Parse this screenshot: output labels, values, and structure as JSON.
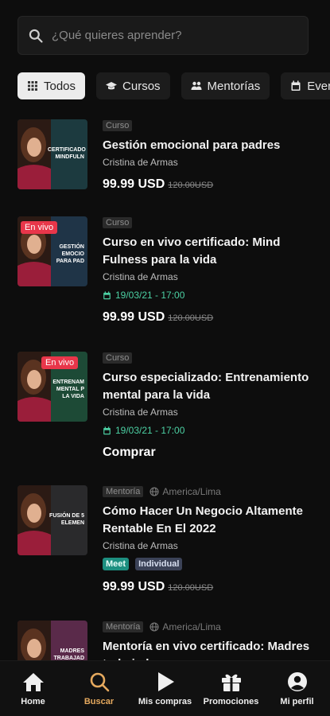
{
  "search": {
    "placeholder": "¿Qué quieres aprender?"
  },
  "filters": [
    {
      "label": "Todos",
      "icon": "grid-icon"
    },
    {
      "label": "Cursos",
      "icon": "graduation-cap-icon"
    },
    {
      "label": "Mentorías",
      "icon": "users-icon"
    },
    {
      "label": "Even",
      "icon": "calendar-icon"
    }
  ],
  "items": [
    {
      "type": "Curso",
      "title": "Gestión emocional para padres",
      "author": "Cristina de Armas",
      "price": "99.99 USD",
      "old_price": "120.00USD",
      "thumb_text": "Certificado MINDFULN",
      "thumb_bg": "#1c3a3f"
    },
    {
      "type": "Curso",
      "live": "En vivo",
      "title": "Curso en vivo certificado: Mind Fulness para la vida",
      "author": "Cristina de Armas",
      "date": "19/03/21 - 17:00",
      "price": "99.99 USD",
      "old_price": "120.00USD",
      "thumb_text": "Gestión emocio para pad",
      "thumb_bg": "#1f3447"
    },
    {
      "type": "Curso",
      "live": "En vivo",
      "title": "Curso especializado: Entrenamiento mental para la vida",
      "author": "Cristina de Armas",
      "date": "19/03/21 - 17:00",
      "cta": "Comprar",
      "thumb_text": "Entrenam mental p la vida",
      "thumb_bg": "#1d4a36"
    },
    {
      "type": "Mentoría",
      "timezone": "America/Lima",
      "title": "Cómo Hacer Un Negocio Altamente Rentable En El 2022",
      "author": "Cristina de Armas",
      "badges": [
        "Meet",
        "Individual"
      ],
      "price": "99.99 USD",
      "old_price": "120.00USD",
      "thumb_text": "Fusión de 5 elemen",
      "thumb_bg": "#2a2a2c"
    },
    {
      "type": "Mentoría",
      "timezone": "America/Lima",
      "title": "Mentoría en vivo certificado: Madres trabajadoras",
      "thumb_text": "Madres trabajad",
      "thumb_bg": "#5a2a4a"
    }
  ],
  "nav": [
    {
      "label": "Home",
      "icon": "home-icon"
    },
    {
      "label": "Buscar",
      "icon": "search-icon",
      "active": true
    },
    {
      "label": "Mis compras",
      "icon": "play-icon"
    },
    {
      "label": "Promociones",
      "icon": "gift-icon"
    },
    {
      "label": "Mi perfil",
      "icon": "profile-icon"
    }
  ],
  "colors": {
    "accent": "#e5a95e",
    "live": "#e8364a",
    "date": "#4cd0a3",
    "background": "#0d0d0d"
  }
}
